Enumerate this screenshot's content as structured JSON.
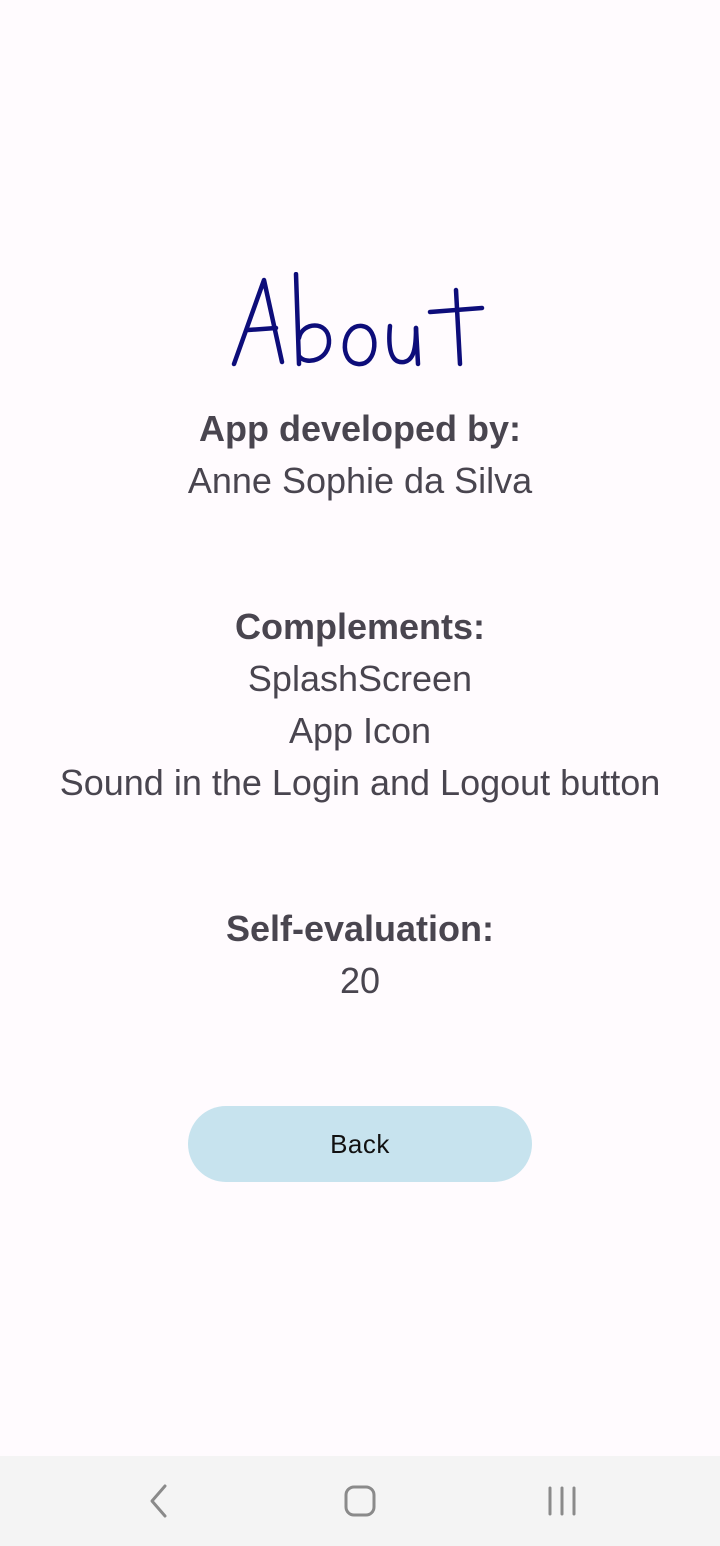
{
  "about": {
    "title": "About"
  },
  "developer": {
    "heading": "App developed by:",
    "name": "Anne Sophie da Silva"
  },
  "complements": {
    "heading": "Complements:",
    "items": [
      "SplashScreen",
      "App Icon",
      "Sound in the Login and Logout button"
    ]
  },
  "evaluation": {
    "heading": "Self-evaluation:",
    "value": "20"
  },
  "actions": {
    "back_label": "Back"
  },
  "colors": {
    "title": "#0d0d7a",
    "text": "#49454f",
    "button_bg": "#c7e3ee",
    "background": "#fffbfe",
    "navbar_bg": "#f4f4f4",
    "nav_icon": "#8a8a8a"
  },
  "navbar": {
    "icons": [
      "back-chevron-icon",
      "home-icon",
      "recents-icon"
    ]
  }
}
